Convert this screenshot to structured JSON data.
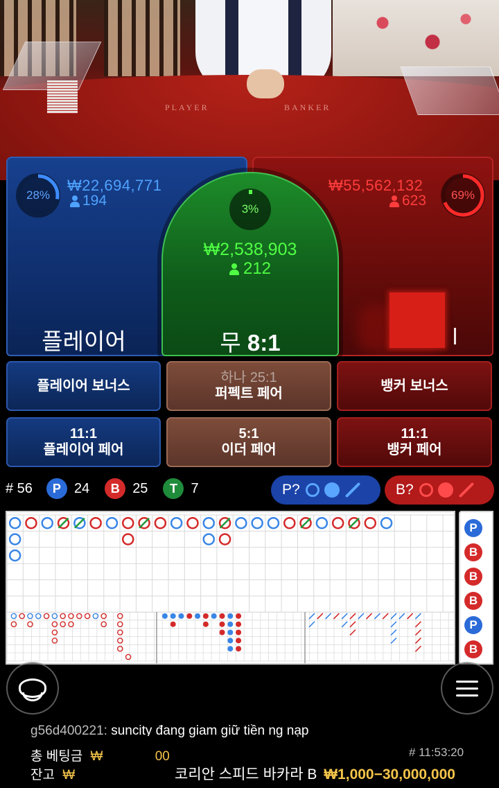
{
  "table": {
    "felt_player": "PLAYER",
    "felt_banker": "BANKER"
  },
  "player": {
    "percent": "28%",
    "percent_value": 28,
    "amount": "₩22,694,771",
    "count": "194",
    "label": "플레이어"
  },
  "tie": {
    "percent": "3%",
    "percent_value": 3,
    "amount": "₩2,538,903",
    "count": "212",
    "label_prefix": "무",
    "label_odds": "8:1"
  },
  "banker": {
    "percent": "69%",
    "percent_value": 69,
    "amount": "₩55,562,132",
    "count": "623"
  },
  "side_bets": {
    "player_bonus": "플레이어 보너스",
    "perfect_pair_sub": "하나 25:1",
    "perfect_pair": "퍼펙트 페어",
    "banker_bonus": "뱅커 보너스",
    "player_pair_odds": "11:1",
    "player_pair": "플레이어 페어",
    "either_pair_odds": "5:1",
    "either_pair": "이더 페어",
    "banker_pair_odds": "11:1",
    "banker_pair": "뱅커 페어"
  },
  "stats": {
    "round_label": "# 56",
    "p_icon": "P",
    "p_count": "24",
    "b_icon": "B",
    "b_count": "25",
    "t_icon": "T",
    "t_count": "7"
  },
  "predict": {
    "player": "P?",
    "banker": "B?"
  },
  "side_road": [
    "P",
    "B",
    "B",
    "B",
    "P",
    "B"
  ],
  "bottom": {
    "chat_user": "g56d400221:",
    "chat_msg": "suncity đang giam giữ tiền ng nạp",
    "total_bet_label": "총 베팅금",
    "total_bet_value": "₩",
    "total_bet_tail": "00",
    "balance_label": "잔고",
    "balance_value": "₩",
    "round_no": "# 11:53:20",
    "table_name": "코리안 스피드 바카라 B",
    "limits": "₩1,000−30,000,000"
  },
  "colors": {
    "player": "#2b6bd8",
    "banker": "#d42a2a",
    "tie": "#1f8c3b",
    "gold": "#f5c54a"
  }
}
